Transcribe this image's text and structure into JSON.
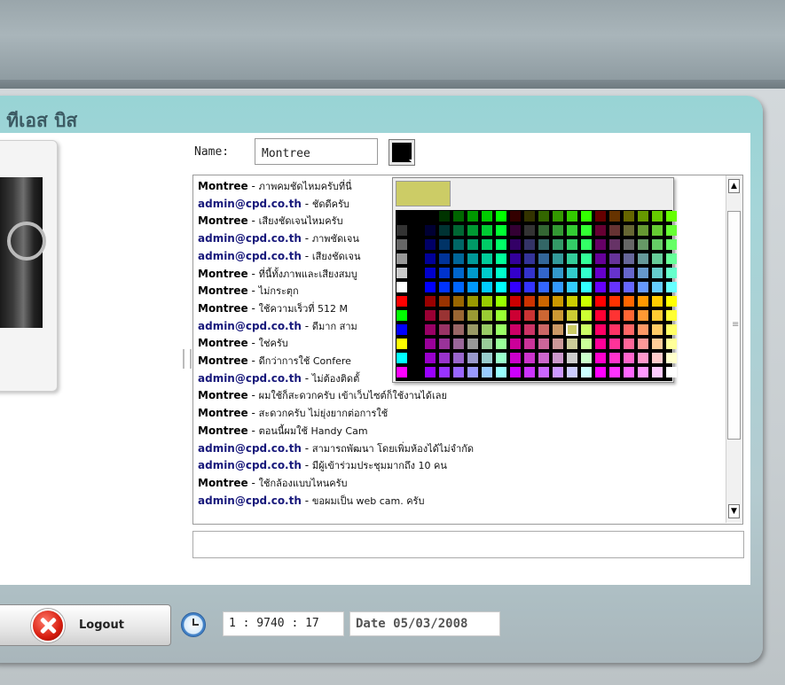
{
  "room": {
    "title": "ุ ทีเอส บิส"
  },
  "chat": {
    "name_label": "Name:",
    "name_value": "Montree",
    "selected_color": "#000000",
    "messages": [
      {
        "user": "Montree",
        "text": "ภาพคมชัดไหมครับที่นี่"
      },
      {
        "user": "admin@cpd.co.th",
        "text": "ชัดดีครับ"
      },
      {
        "user": "Montree",
        "text": "เสียงชัดเจนไหมครับ"
      },
      {
        "user": "admin@cpd.co.th",
        "text": "ภาพชัดเจน"
      },
      {
        "user": "admin@cpd.co.th",
        "text": "เสียงชัดเจน"
      },
      {
        "user": "Montree",
        "text": "ที่นี้ทั้งภาพและเสียงสมบู"
      },
      {
        "user": "Montree",
        "text": "ไม่กระตุก"
      },
      {
        "user": "Montree",
        "text": "ใช้ความเร็วที่ 512 M"
      },
      {
        "user": "admin@cpd.co.th",
        "text": "ดีมาก สาม"
      },
      {
        "user": "Montree",
        "text": "ใช่ครับ"
      },
      {
        "user": "Montree",
        "text": "ดีกว่าการใช้ Confere"
      },
      {
        "user": "admin@cpd.co.th",
        "text": "ไม่ต้องติดตั้"
      },
      {
        "user": "Montree",
        "text": "ผมใช้ก็สะดวกครับ เข้าเว็บไซต์ก็ใช้งานได้เลย"
      },
      {
        "user": "Montree",
        "text": "สะดวกครับ ไม่ยุ่งยากต่อการใช้"
      },
      {
        "user": "Montree",
        "text": "ตอนนี้ผมใช้ Handy Cam"
      },
      {
        "user": "admin@cpd.co.th",
        "text": "สามารถพัฒนา โดยเพิ่มห้องได้ไม่จำกัด"
      },
      {
        "user": "admin@cpd.co.th",
        "text": "มีผู้เข้าร่วมประชุมมากถึง 10 คน"
      },
      {
        "user": "Montree",
        "text": "ใช้กล้องแบบไหนครับ"
      },
      {
        "user": "admin@cpd.co.th",
        "text": "ขอผมเป็น web cam. ครับ"
      }
    ],
    "separator": " - ",
    "message_input_value": ""
  },
  "palette": {
    "preview_color": "#CCCC66",
    "hovered_color": "#CCCC66"
  },
  "footer": {
    "logout_label": "Logout",
    "time": "1 : 9740 : 17",
    "date": "Date 05/03/2008"
  },
  "scrollbar": {
    "up": "▲",
    "down": "▼",
    "grip": "≡"
  }
}
